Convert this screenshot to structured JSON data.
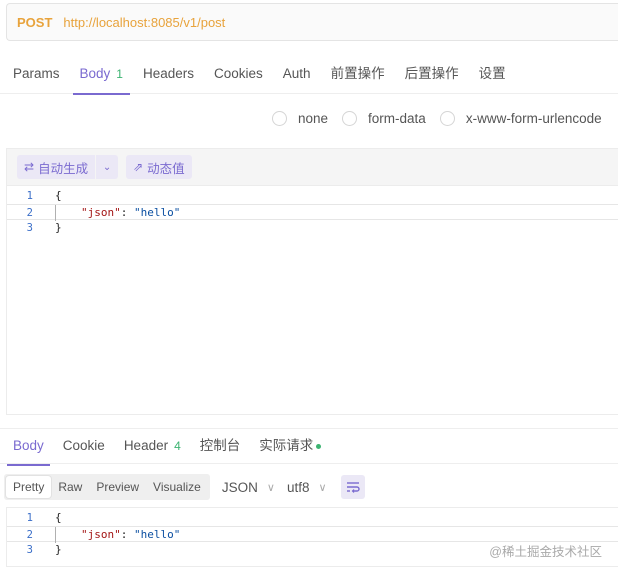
{
  "request": {
    "method": "POST",
    "url": "http://localhost:8085/v1/post"
  },
  "request_tabs": [
    {
      "label": "Params"
    },
    {
      "label": "Body",
      "badge": "1",
      "active": true
    },
    {
      "label": "Headers"
    },
    {
      "label": "Cookies"
    },
    {
      "label": "Auth"
    },
    {
      "label": "前置操作"
    },
    {
      "label": "后置操作"
    },
    {
      "label": "设置"
    }
  ],
  "body_types": [
    "none",
    "form-data",
    "x-www-form-urlencode"
  ],
  "toolbar": {
    "auto_generate": "自动生成",
    "dynamic_value": "动态值"
  },
  "request_code": {
    "line_numbers": [
      "1",
      "2",
      "3"
    ],
    "open_brace": "{",
    "key": "\"json\"",
    "separator": ": ",
    "value": "\"hello\"",
    "close_brace": "}"
  },
  "response_tabs": [
    {
      "label": "Body",
      "active": true
    },
    {
      "label": "Cookie"
    },
    {
      "label": "Header",
      "badge": "4"
    },
    {
      "label": "控制台"
    },
    {
      "label": "实际请求",
      "dot": true
    }
  ],
  "response_toolbar": {
    "views": [
      "Pretty",
      "Raw",
      "Preview",
      "Visualize"
    ],
    "active_view": "Pretty",
    "format": "JSON",
    "encoding": "utf8"
  },
  "response_code": {
    "line_numbers": [
      "1",
      "2",
      "3"
    ],
    "open_brace": "{",
    "key": "\"json\"",
    "separator": ": ",
    "value": "\"hello\"",
    "close_brace": "}"
  },
  "watermark": "@稀土掘金技术社区",
  "colors": {
    "accent": "#7a6ad0",
    "method": "#e8a33c",
    "badge": "#3cb371"
  }
}
